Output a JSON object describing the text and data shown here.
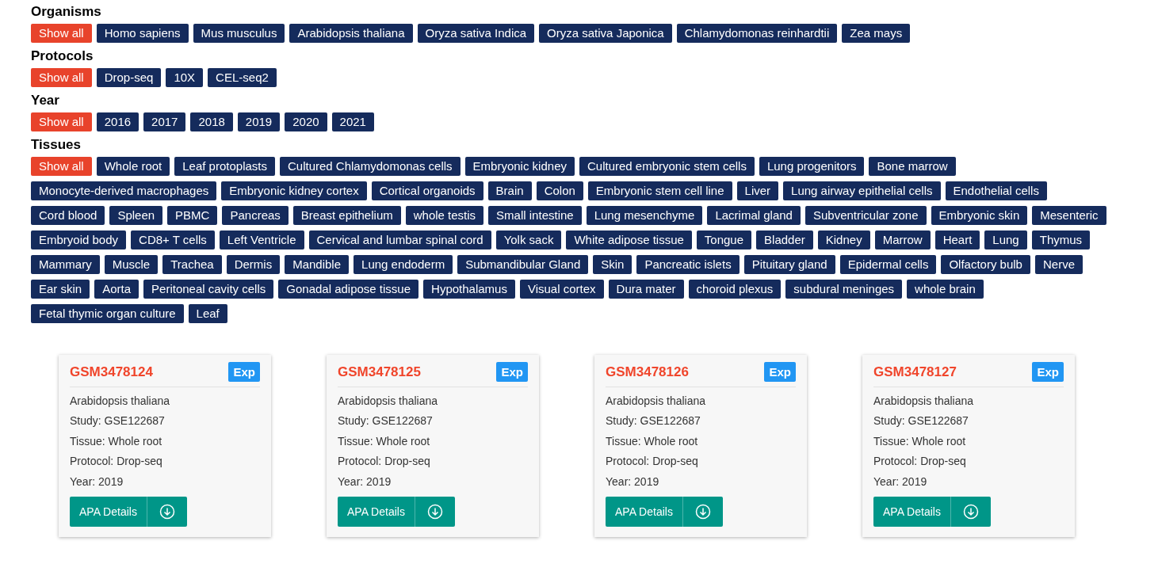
{
  "filters": [
    {
      "title": "Organisms",
      "options": [
        {
          "label": "Show all",
          "selected": true
        },
        {
          "label": "Homo sapiens",
          "selected": false
        },
        {
          "label": "Mus musculus",
          "selected": false
        },
        {
          "label": "Arabidopsis thaliana",
          "selected": false
        },
        {
          "label": "Oryza sativa Indica",
          "selected": false
        },
        {
          "label": "Oryza sativa Japonica",
          "selected": false
        },
        {
          "label": "Chlamydomonas reinhardtii",
          "selected": false
        },
        {
          "label": "Zea mays",
          "selected": false
        }
      ]
    },
    {
      "title": "Protocols",
      "options": [
        {
          "label": "Show all",
          "selected": true
        },
        {
          "label": "Drop-seq",
          "selected": false
        },
        {
          "label": "10X",
          "selected": false
        },
        {
          "label": "CEL-seq2",
          "selected": false
        }
      ]
    },
    {
      "title": "Year",
      "options": [
        {
          "label": "Show all",
          "selected": true
        },
        {
          "label": "2016",
          "selected": false
        },
        {
          "label": "2017",
          "selected": false
        },
        {
          "label": "2018",
          "selected": false
        },
        {
          "label": "2019",
          "selected": false
        },
        {
          "label": "2020",
          "selected": false
        },
        {
          "label": "2021",
          "selected": false
        }
      ]
    },
    {
      "title": "Tissues",
      "options": [
        {
          "label": "Show all",
          "selected": true
        },
        {
          "label": "Whole root",
          "selected": false
        },
        {
          "label": "Leaf protoplasts",
          "selected": false
        },
        {
          "label": "Cultured Chlamydomonas cells",
          "selected": false
        },
        {
          "label": "Embryonic kidney",
          "selected": false
        },
        {
          "label": "Cultured embryonic stem cells",
          "selected": false
        },
        {
          "label": "Lung progenitors",
          "selected": false
        },
        {
          "label": "Bone marrow",
          "selected": false
        },
        {
          "label": "Monocyte-derived macrophages",
          "selected": false
        },
        {
          "label": "Embryonic kidney cortex",
          "selected": false
        },
        {
          "label": "Cortical organoids",
          "selected": false
        },
        {
          "label": "Brain",
          "selected": false
        },
        {
          "label": "Colon",
          "selected": false
        },
        {
          "label": "Embryonic stem cell line",
          "selected": false
        },
        {
          "label": "Liver",
          "selected": false
        },
        {
          "label": "Lung airway epithelial cells",
          "selected": false
        },
        {
          "label": "Endothelial cells",
          "selected": false
        },
        {
          "label": "Cord blood",
          "selected": false
        },
        {
          "label": "Spleen",
          "selected": false
        },
        {
          "label": "PBMC",
          "selected": false
        },
        {
          "label": "Pancreas",
          "selected": false
        },
        {
          "label": "Breast epithelium",
          "selected": false
        },
        {
          "label": "whole testis",
          "selected": false
        },
        {
          "label": "Small intestine",
          "selected": false
        },
        {
          "label": "Lung mesenchyme",
          "selected": false
        },
        {
          "label": "Lacrimal gland",
          "selected": false
        },
        {
          "label": "Subventricular zone",
          "selected": false
        },
        {
          "label": "Embryonic skin",
          "selected": false
        },
        {
          "label": "Mesenteric",
          "selected": false
        },
        {
          "label": "Embryoid body",
          "selected": false
        },
        {
          "label": "CD8+ T cells",
          "selected": false
        },
        {
          "label": "Left Ventricle",
          "selected": false
        },
        {
          "label": "Cervical and lumbar spinal cord",
          "selected": false
        },
        {
          "label": "Yolk sack",
          "selected": false
        },
        {
          "label": "White adipose tissue",
          "selected": false
        },
        {
          "label": "Tongue",
          "selected": false
        },
        {
          "label": "Bladder",
          "selected": false
        },
        {
          "label": "Kidney",
          "selected": false
        },
        {
          "label": "Marrow",
          "selected": false
        },
        {
          "label": "Heart",
          "selected": false
        },
        {
          "label": "Lung",
          "selected": false
        },
        {
          "label": "Thymus",
          "selected": false
        },
        {
          "label": "Mammary",
          "selected": false
        },
        {
          "label": "Muscle",
          "selected": false
        },
        {
          "label": "Trachea",
          "selected": false
        },
        {
          "label": "Dermis",
          "selected": false
        },
        {
          "label": "Mandible",
          "selected": false
        },
        {
          "label": "Lung endoderm",
          "selected": false
        },
        {
          "label": "Submandibular Gland",
          "selected": false
        },
        {
          "label": "Skin",
          "selected": false
        },
        {
          "label": "Pancreatic islets",
          "selected": false
        },
        {
          "label": "Pituitary gland",
          "selected": false
        },
        {
          "label": "Epidermal cells",
          "selected": false
        },
        {
          "label": "Olfactory bulb",
          "selected": false
        },
        {
          "label": "Nerve",
          "selected": false
        },
        {
          "label": "Ear skin",
          "selected": false
        },
        {
          "label": "Aorta",
          "selected": false
        },
        {
          "label": "Peritoneal cavity cells",
          "selected": false
        },
        {
          "label": "Gonadal adipose tissue",
          "selected": false
        },
        {
          "label": "Hypothalamus",
          "selected": false
        },
        {
          "label": "Visual cortex",
          "selected": false
        },
        {
          "label": "Dura mater",
          "selected": false
        },
        {
          "label": "choroid plexus",
          "selected": false
        },
        {
          "label": "subdural meninges",
          "selected": false
        },
        {
          "label": "whole brain",
          "selected": false
        },
        {
          "label": "Fetal thymic organ culture",
          "selected": false
        },
        {
          "label": "Leaf",
          "selected": false
        }
      ]
    }
  ],
  "cards": [
    {
      "id": "GSM3478124",
      "badge": "Exp",
      "organism": "Arabidopsis thaliana",
      "study": "Study: GSE122687",
      "tissue": "Tissue: Whole root",
      "protocol": "Protocol: Drop-seq",
      "year": "Year: 2019",
      "button": "APA Details"
    },
    {
      "id": "GSM3478125",
      "badge": "Exp",
      "organism": "Arabidopsis thaliana",
      "study": "Study: GSE122687",
      "tissue": "Tissue: Whole root",
      "protocol": "Protocol: Drop-seq",
      "year": "Year: 2019",
      "button": "APA Details"
    },
    {
      "id": "GSM3478126",
      "badge": "Exp",
      "organism": "Arabidopsis thaliana",
      "study": "Study: GSE122687",
      "tissue": "Tissue: Whole root",
      "protocol": "Protocol: Drop-seq",
      "year": "Year: 2019",
      "button": "APA Details"
    },
    {
      "id": "GSM3478127",
      "badge": "Exp",
      "organism": "Arabidopsis thaliana",
      "study": "Study: GSE122687",
      "tissue": "Tissue: Whole root",
      "protocol": "Protocol: Drop-seq",
      "year": "Year: 2019",
      "button": "APA Details"
    }
  ]
}
